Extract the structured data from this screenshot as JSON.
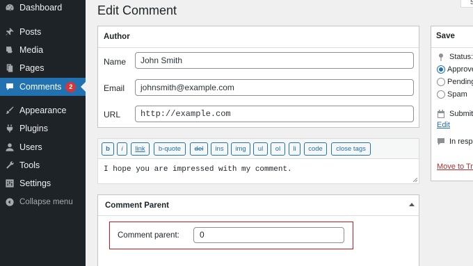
{
  "sidebar": {
    "items": [
      {
        "label": "Dashboard",
        "icon": "dashboard-icon"
      },
      {
        "label": "Posts",
        "icon": "pin-icon"
      },
      {
        "label": "Media",
        "icon": "media-icon"
      },
      {
        "label": "Pages",
        "icon": "pages-icon"
      },
      {
        "label": "Comments",
        "icon": "comment-icon",
        "badge": "2",
        "active": true
      },
      {
        "label": "Appearance",
        "icon": "brush-icon"
      },
      {
        "label": "Plugins",
        "icon": "plugin-icon"
      },
      {
        "label": "Users",
        "icon": "user-icon"
      },
      {
        "label": "Tools",
        "icon": "wrench-icon"
      },
      {
        "label": "Settings",
        "icon": "settings-icon"
      },
      {
        "label": "Collapse menu",
        "icon": "collapse-icon"
      }
    ]
  },
  "header": {
    "title": "Edit Comment",
    "screen_options": "S"
  },
  "author_box": {
    "title": "Author",
    "name_label": "Name",
    "name_value": "John Smith",
    "email_label": "Email",
    "email_value": "johnsmith@example.com",
    "url_label": "URL",
    "url_value": "http://example.com"
  },
  "editor": {
    "buttons": [
      "b",
      "i",
      "link",
      "b-quote",
      "del",
      "ins",
      "img",
      "ul",
      "ol",
      "li",
      "code",
      "close tags"
    ],
    "content": "I hope you are impressed with my comment."
  },
  "comment_parent": {
    "title": "Comment Parent",
    "label": "Comment parent:",
    "value": "0"
  },
  "save_box": {
    "title": "Save",
    "status_label": "Status:",
    "options": [
      "Approve",
      "Pending",
      "Spam"
    ],
    "selected": "Approve",
    "submitted": "Submit",
    "edit_link": "Edit",
    "in_response": "In resp",
    "trash_link": "Move to Tra"
  },
  "colors": {
    "sidebar_bg": "#1d2327",
    "accent": "#2271b1",
    "badge": "#d63638",
    "highlight_border": "#c8161d"
  }
}
